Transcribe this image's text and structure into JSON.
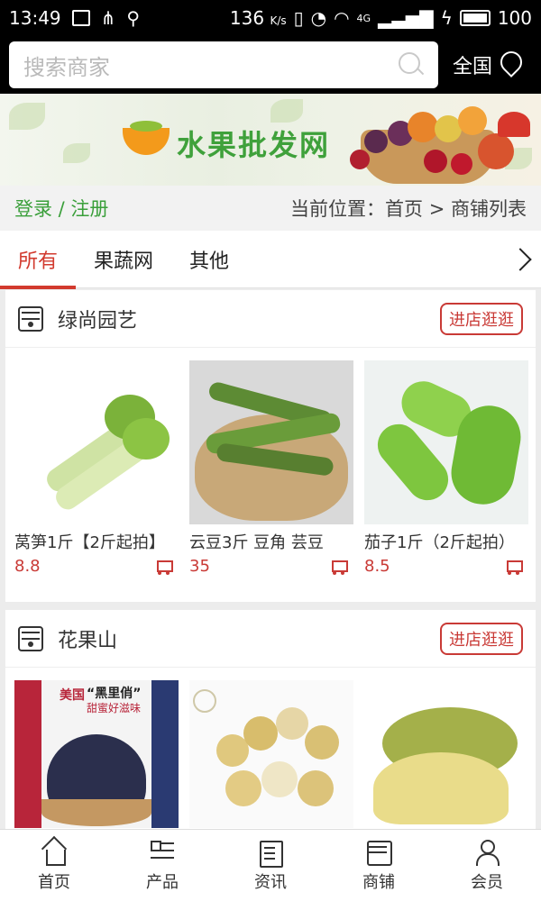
{
  "status_bar": {
    "time": "13:49",
    "speed": "136",
    "speed_unit": "K/s",
    "network": "4G",
    "battery": "100"
  },
  "header": {
    "search_placeholder": "搜索商家",
    "region": "全国"
  },
  "banner": {
    "title": "水果批发网"
  },
  "breadcrumb_bar": {
    "login": "登录 / 注册",
    "location": "当前位置：首页 > 商铺列表"
  },
  "tabs": [
    {
      "label": "所有"
    },
    {
      "label": "果蔬网"
    },
    {
      "label": "其他"
    }
  ],
  "shops": [
    {
      "name": "绿尚园艺",
      "enter_label": "进店逛逛",
      "products": [
        {
          "name": "莴笋1斤【2斤起拍】",
          "price": "8.8"
        },
        {
          "name": "云豆3斤 豆角 芸豆",
          "price": "35"
        },
        {
          "name": "茄子1斤（2斤起拍）",
          "price": "8.5"
        }
      ]
    },
    {
      "name": "花果山",
      "enter_label": "进店逛逛",
      "product_image_text": {
        "brand_prefix": "美国",
        "brand": "“黑里俏”",
        "slogan": "甜蜜好滋味"
      }
    }
  ],
  "bottom_nav": [
    {
      "label": "首页",
      "icon": "home-icon"
    },
    {
      "label": "产品",
      "icon": "list-icon"
    },
    {
      "label": "资讯",
      "icon": "news-icon"
    },
    {
      "label": "商铺",
      "icon": "shop-icon"
    },
    {
      "label": "会员",
      "icon": "user-icon"
    }
  ]
}
